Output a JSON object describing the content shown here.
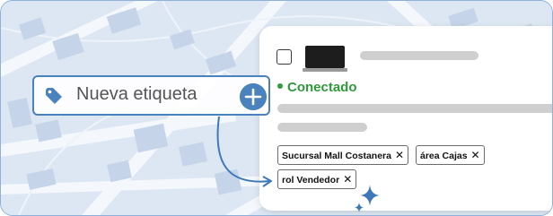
{
  "new_tag": {
    "placeholder": "Nueva etiqueta",
    "tag_icon": "tag-icon",
    "add_icon": "plus-icon"
  },
  "card": {
    "status": "Conectado",
    "status_color": "#2f9a3b",
    "device_icon": "laptop-icon",
    "tags": [
      {
        "label": "Sucursal Mall Costanera"
      },
      {
        "label": "área Cajas"
      },
      {
        "label": "rol Vendedor"
      }
    ]
  },
  "colors": {
    "accent": "#4a82be",
    "map_background": "#dde7f4"
  }
}
